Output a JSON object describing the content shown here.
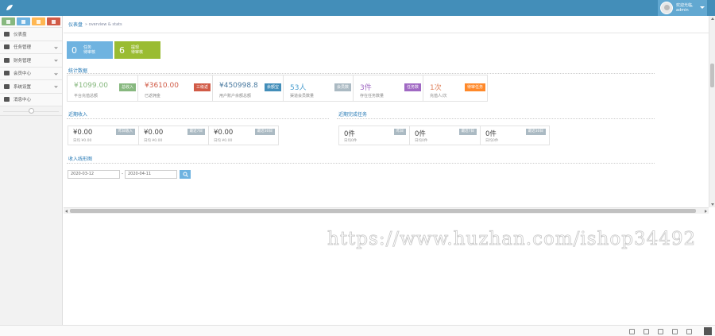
{
  "header": {
    "greeting": "欢迎光临,",
    "username": "admin"
  },
  "sidebar": {
    "items": [
      {
        "label": "仪表盘",
        "icon": "dashboard-icon"
      },
      {
        "label": "任务管理",
        "icon": "flag-icon"
      },
      {
        "label": "财务管理",
        "icon": "briefcase-icon"
      },
      {
        "label": "会员中心",
        "icon": "user-icon"
      },
      {
        "label": "系统设置",
        "icon": "gear-icon"
      },
      {
        "label": "消息中心",
        "icon": "book-icon"
      }
    ]
  },
  "breadcrumb": {
    "title": "仪表盘",
    "subtitle": "» overview & stats"
  },
  "tasks": [
    {
      "count": "0",
      "label1": "任务",
      "label2": "待审核",
      "color": "#6fb3e0"
    },
    {
      "count": "6",
      "label1": "提现",
      "label2": "待审核",
      "color": "#9abc32"
    }
  ],
  "stats": {
    "title": "统计数据",
    "items": [
      {
        "value": "¥1099.00",
        "label": "平台充值总额",
        "tag": "总收入",
        "color": "#87b87f",
        "tagColor": "#87b87f"
      },
      {
        "value": "¥3610.00",
        "label": "已返佣金",
        "tag": "三级返",
        "color": "#d15b47",
        "tagColor": "#d15b47"
      },
      {
        "value": "¥450998.8",
        "label": "用户账户余额总额",
        "tag": "余额宝",
        "color": "#4a7aa0",
        "tagColor": "#438eb9"
      },
      {
        "value": "53人",
        "label": "渠道会员数量",
        "tag": "会员数",
        "color": "#4a9ecf",
        "tagColor": "#abbac3"
      },
      {
        "value": "3件",
        "label": "存在任务数量",
        "tag": "任务数",
        "color": "#a069c3",
        "tagColor": "#a069c3"
      },
      {
        "value": "1次",
        "label": "充值人/次",
        "tag": "待审任务",
        "color": "#e0835d",
        "tagColor": "#ff892a"
      }
    ]
  },
  "income": {
    "title": "近期收入",
    "cards": [
      {
        "value": "¥0.00",
        "label": "日均 ¥0.00",
        "tag": "昨日收入"
      },
      {
        "value": "¥0.00",
        "label": "日均 ¥0.00",
        "tag": "最近7日"
      },
      {
        "value": "¥0.00",
        "label": "日均 ¥0.00",
        "tag": "最近30日"
      }
    ]
  },
  "completed": {
    "title": "近期完成任务",
    "cards": [
      {
        "value": "0件",
        "label": "日均0件",
        "tag": "昨日"
      },
      {
        "value": "0件",
        "label": "日均0件",
        "tag": "最近7日"
      },
      {
        "value": "0件",
        "label": "日均0件",
        "tag": "最近30日"
      }
    ]
  },
  "chart": {
    "title": "收入线形图",
    "start_date": "2020-03-12",
    "end_date": "2020-04-11",
    "separator": "-"
  },
  "watermark": "https://www.huzhan.com/ishop34492"
}
